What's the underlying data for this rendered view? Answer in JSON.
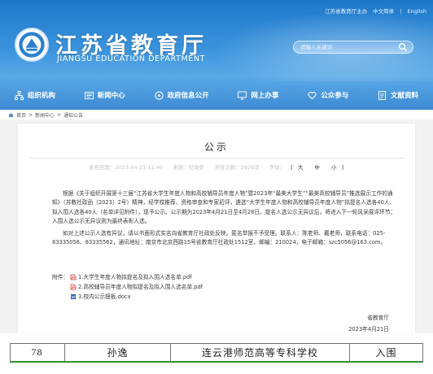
{
  "header": {
    "top_links": [
      "江苏省教育厅主办",
      "中文简体",
      "English"
    ],
    "logo_cn": "江苏省教育厅",
    "logo_en": "JIANGSU EDUCATION DEPARTMENT",
    "search_placeholder": "请输入关键词",
    "icons": [
      "emblem-icon",
      "search-icon"
    ]
  },
  "nav": {
    "items": [
      {
        "label": "组织机构",
        "icon": "org-chart-icon"
      },
      {
        "label": "新闻中心",
        "icon": "news-icon"
      },
      {
        "label": "政府信息公开",
        "icon": "info-open-icon"
      },
      {
        "label": "网上办事",
        "icon": "monitor-icon"
      },
      {
        "label": "公众参与",
        "icon": "heart-icon"
      },
      {
        "label": "文献资料",
        "icon": "document-icon"
      }
    ]
  },
  "breadcrumb": [
    "首页",
    "新闻中心",
    "通知公告"
  ],
  "article": {
    "title": "公示",
    "publish_date": "发布日期：2023-04-21 11:40",
    "source": "来源：社政处",
    "views": "浏览次数：2929次",
    "font_size_label": "字体：",
    "font_sizes": [
      "大",
      "中",
      "小"
    ],
    "paragraph1": "根据《关于组织开展第十三届“江苏省大学生年度人物和高校辅导员年度人物”暨2023年“最美大学生”“最美高校辅导员”推选展示工作的通知》（苏教社政函〔2023〕2号）精神，经学校推荐、资格审查和专家初评，遴选“大学生年度人物和高校辅导员年度人物”拟提名人选各40人、拟入围人选各40人（名单详见附件），现予公示。公示期为2023年4月21日至4月28日。提名人选公示无异议后，将进入下一轮风采展评环节；入围人选公示无异议则为最终表彰人选。",
    "paragraph2": "如对上述公示人选有异议，请以书面形式实名向省教育厅社政处反映。匿名举报不予受理。联系人：陈老师、戴老师，联系电话：025-83335056、83335562，通讯地址：南京市北京西路15号省教育厅社政处1512室，邮编：210024，电子邮箱：szc5056@163.com。",
    "attachments_label": "附件：",
    "attachments": [
      {
        "name": "1.大学生年度人物拟提名及拟入围人选名单.pdf",
        "icon": "pdf-icon"
      },
      {
        "name": "2.高校辅导员年度人物拟提名及拟入围人选名单.pdf",
        "icon": "pdf-icon"
      },
      {
        "name": "3.校内公示模板.docx",
        "icon": "word-icon"
      }
    ],
    "signature": "省教育厅",
    "signature_date": "2023年4月21日"
  },
  "table_row": {
    "no": "78",
    "name": "孙逸",
    "school": "连云港师范高等专科学校",
    "status": "入围"
  },
  "colors": {
    "banner_blue": "#2d86d3",
    "table_bottom_green": "#2f8f3a"
  }
}
